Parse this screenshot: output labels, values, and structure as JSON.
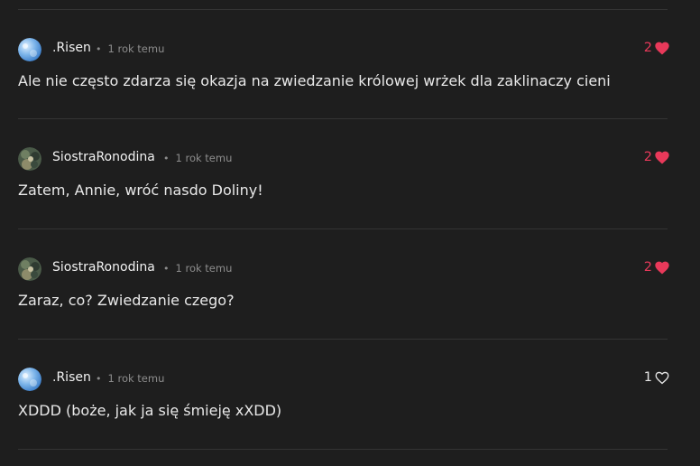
{
  "comments": [
    {
      "author": ".Risen",
      "separator": "•",
      "time": "1 rok temu",
      "likes": "2",
      "liked": true,
      "avatar": "blue-sky-avatar",
      "text": "Ale nie często zdarza się okazja na zwiedzanie królowej wrżek dla zaklinaczy cieni"
    },
    {
      "author": "SiostraRonodina",
      "separator": "•",
      "time": "1 rok temu",
      "likes": "2",
      "liked": true,
      "avatar": "camo-character-avatar",
      "text": "Zatem, Annie, wróć nasdo Doliny!"
    },
    {
      "author": "SiostraRonodina",
      "separator": "•",
      "time": "1 rok temu",
      "likes": "2",
      "liked": true,
      "avatar": "camo-character-avatar",
      "text": "Zaraz, co? Zwiedzanie czego?"
    },
    {
      "author": ".Risen",
      "separator": "•",
      "time": "1 rok temu",
      "likes": "1",
      "liked": false,
      "avatar": "blue-sky-avatar",
      "text": "XDDD (boże, jak ja się śmieję xXDD)"
    }
  ],
  "colors": {
    "background": "#1e1e1e",
    "liked": "#e8395a",
    "divider": "#343434"
  }
}
